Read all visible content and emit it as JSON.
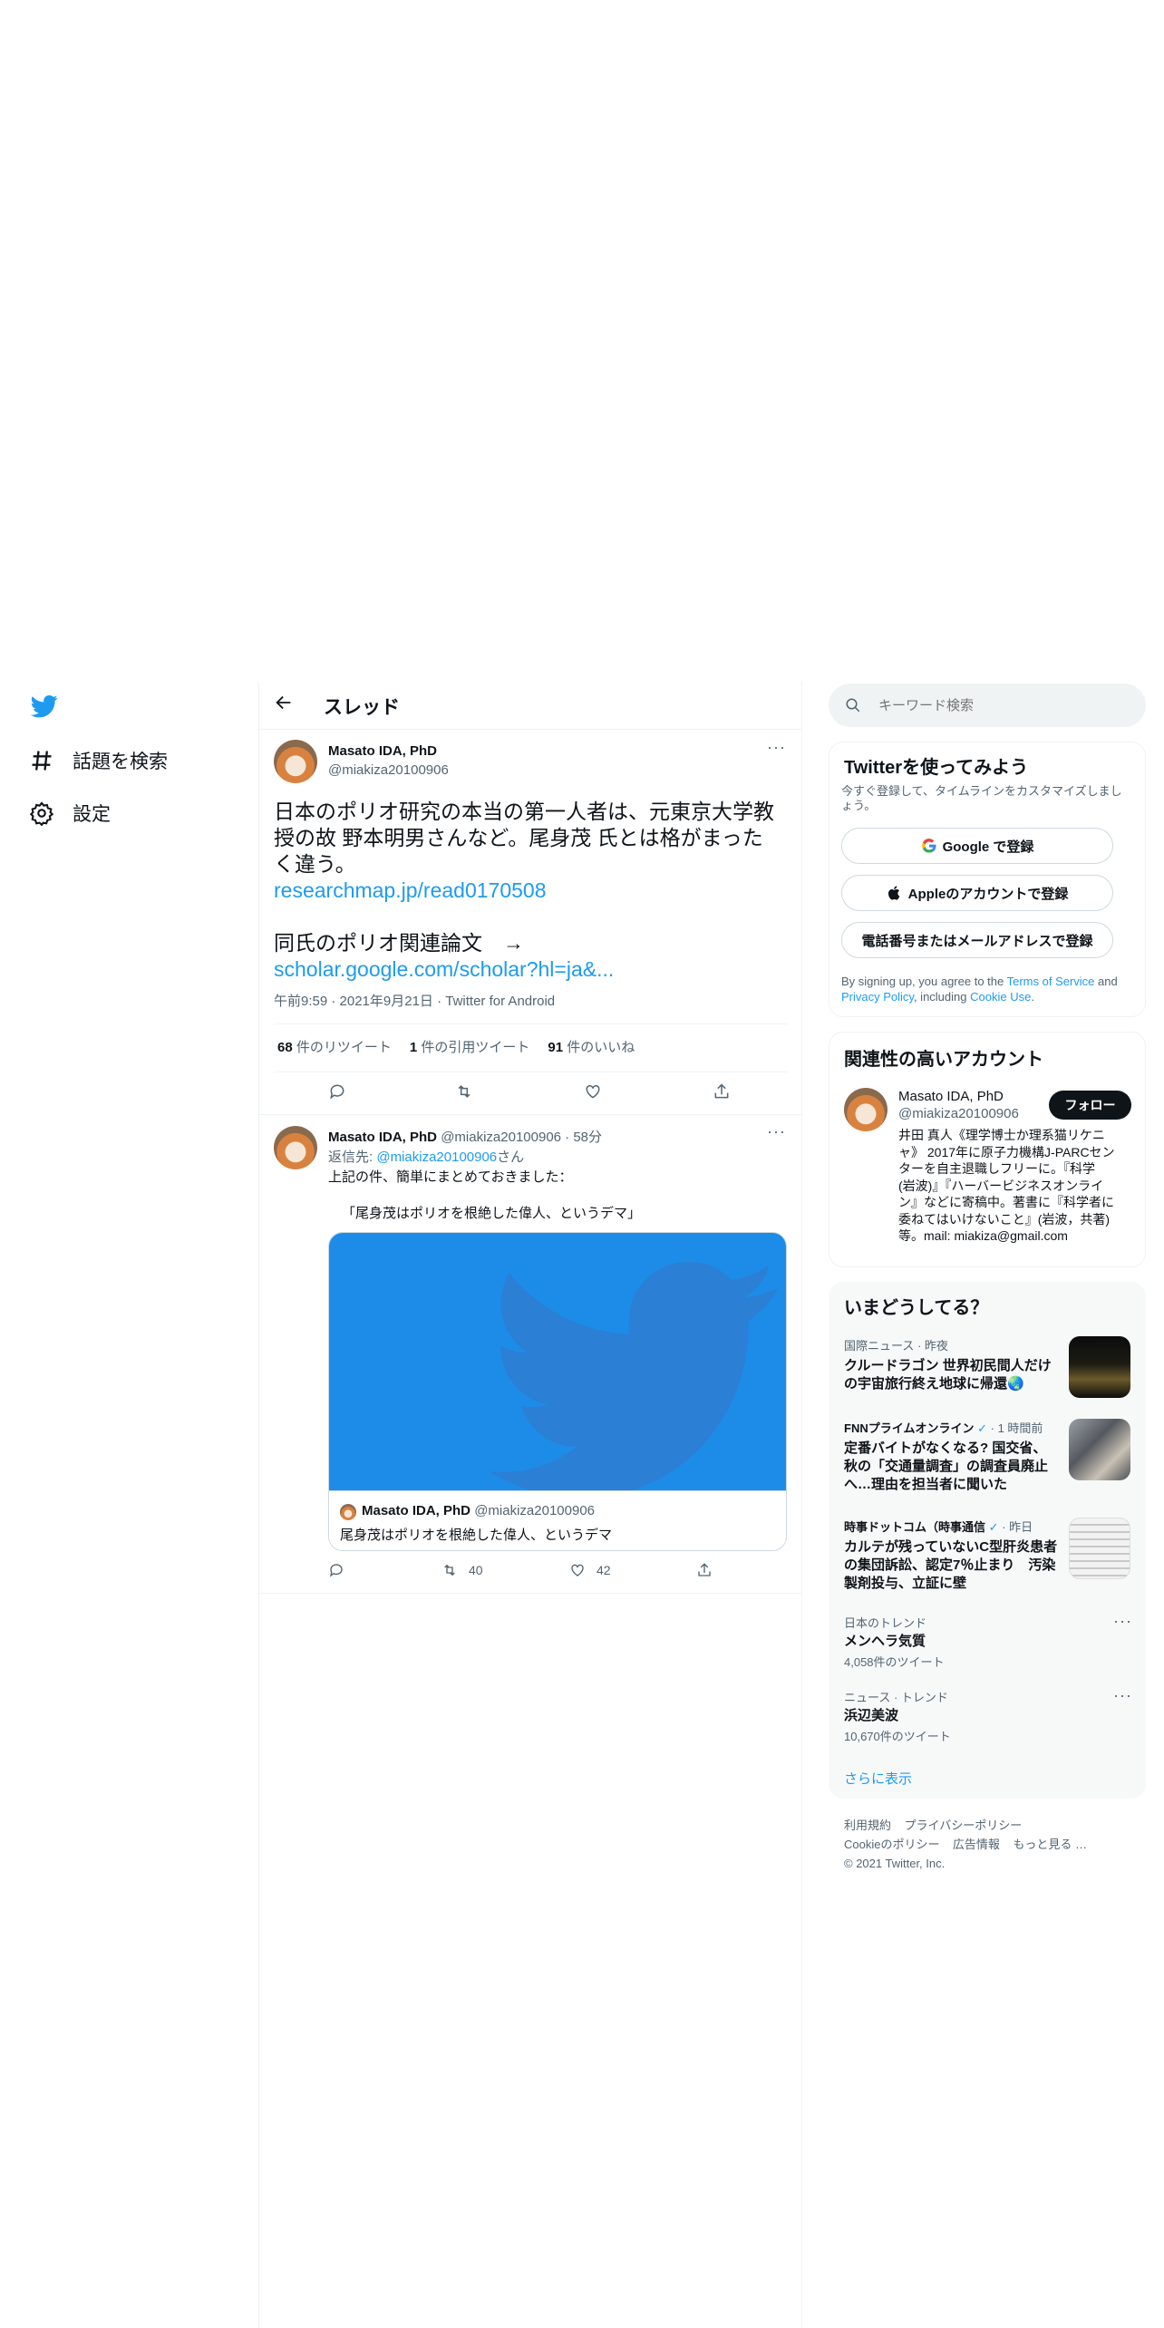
{
  "nav": {
    "explore_label": "話題を検索",
    "settings_label": "設定"
  },
  "header": {
    "title": "スレッド"
  },
  "tweet": {
    "display_name": "Masato IDA, PhD",
    "handle": "@miakiza20100906",
    "text_line1": "日本のポリオ研究の本当の第一人者は、元東京大学教",
    "text_line2": "授の故 野本明男さんなど。尾身茂 氏とは格がまった",
    "text_line3": "く違う。",
    "link1": "researchmap.jp/read0170508",
    "text_line4": "同氏のポリオ関連論文　→",
    "link2": "scholar.google.com/scholar?hl=ja&...",
    "meta": "午前9:59 · 2021年9月21日 · Twitter for Android",
    "retweets_count": "68",
    "retweets_label": "件のリツイート",
    "quotes_count": "1",
    "quotes_label": "件の引用ツイート",
    "likes_count": "91",
    "likes_label": "件のいいね"
  },
  "reply": {
    "display_name": "Masato IDA, PhD",
    "handle_time": "@miakiza20100906 · 58分",
    "reply_to_prefix": "返信先: ",
    "reply_to_handle": "@miakiza20100906",
    "reply_to_suffix": "さん",
    "text_line1": "上記の件、簡単にまとめておきました：",
    "text_line2": "「尾身茂はポリオを根絶した偉人、というデマ」",
    "card": {
      "display_name": "Masato IDA, PhD",
      "handle": "@miakiza20100906",
      "title": "尾身茂はポリオを根絶した偉人、というデマ"
    },
    "retweets": "40",
    "likes": "42"
  },
  "search": {
    "placeholder": "キーワード検索"
  },
  "signup": {
    "title": "Twitterを使ってみよう",
    "subtitle_line1": "今すぐ登録して、タイムラインをカスタマイズしまし",
    "subtitle_line2": "ょう。",
    "google_label": "Google で登録",
    "apple_label": "Appleのアカウントで登録",
    "phone_label": "電話番号またはメールアドレスで登録",
    "terms_pre": "By signing up, you agree to the ",
    "terms_link": "Terms of Service",
    "terms_and": " and",
    "privacy_link": "Privacy Policy",
    "terms_inc": ", including ",
    "cookie_link": "Cookie Use",
    "terms_end": "."
  },
  "related": {
    "title": "関連性の高いアカウント",
    "display_name": "Masato IDA, PhD",
    "handle": "@miakiza20100906",
    "follow_label": "フォロー",
    "bio_lines": [
      "井田 真人《理学博士か理系猫リケニ",
      "ャ》 2017年に原子力機構J-PARCセン",
      "ターを自主退職しフリーに。『科学",
      "(岩波)』『ハーバービジネスオンライ",
      "ン』などに寄稿中。著書に『科学者に",
      "委ねてはいけないこと』(岩波，共著)",
      "等。mail: miakiza@gmail.com"
    ]
  },
  "trends": {
    "title": "いまどうしてる？",
    "news1": {
      "meta": "国際ニュース · 昨夜",
      "line1": "クルードラゴン 世界初民間人だけ",
      "line2": "の宇宙旅行終え地球に帰還🌏"
    },
    "news2": {
      "source": "FNNプライムオンライン",
      "time": "· 1 時間前",
      "line1": "定番バイトがなくなる? 国交省、",
      "line2": "秋の「交通量調査」の調査員廃止",
      "line3": "へ…理由を担当者に聞いた"
    },
    "news3": {
      "source": "時事ドットコム（時事通信",
      "time": "· 昨日",
      "line1": "カルテが残っていないC型肝炎患者",
      "line2": "の集団訴訟、認定7％止まり　汚染",
      "line3": "製剤投与、立証に壁"
    },
    "trend1": {
      "meta": "日本のトレンド",
      "name": "メンヘラ気質",
      "count": "4,058件のツイート"
    },
    "trend2": {
      "meta": "ニュース · トレンド",
      "name": "浜辺美波",
      "count": "10,670件のツイート"
    },
    "show_more": "さらに表示"
  },
  "footer": {
    "links1": [
      "利用規約",
      "プライバシーポリシー"
    ],
    "links2": [
      "Cookieのポリシー",
      "広告情報",
      "もっと見る …"
    ],
    "copyright": "© 2021 Twitter, Inc."
  },
  "colors": {
    "accent": "#1d9bf0",
    "text": "#0f1419",
    "muted": "#536471",
    "border": "#eff3f4",
    "panel": "#f7f9f9"
  }
}
